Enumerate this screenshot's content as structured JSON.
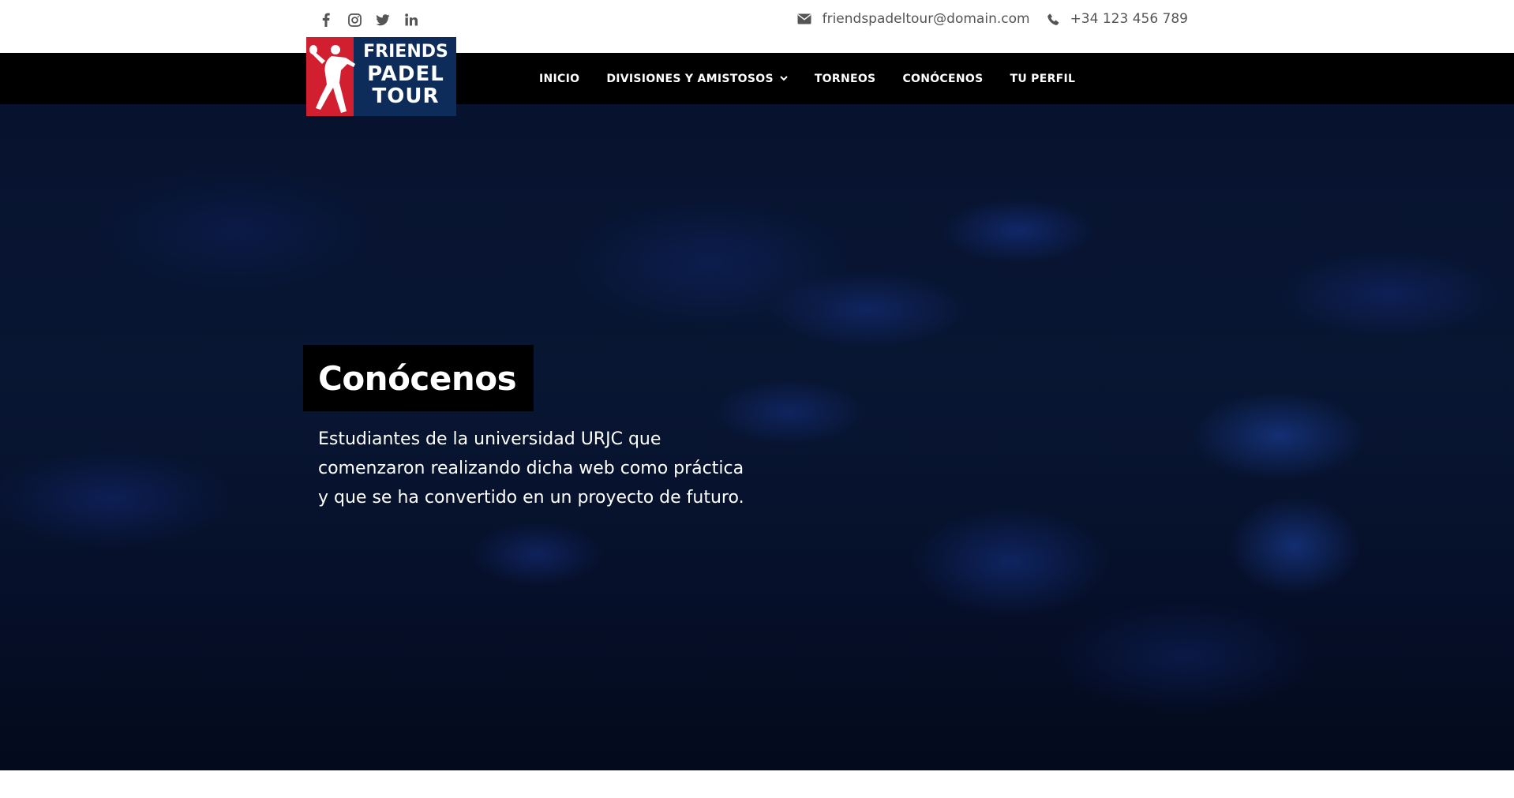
{
  "topbar": {
    "social": [
      {
        "name": "facebook-icon"
      },
      {
        "name": "instagram-icon"
      },
      {
        "name": "twitter-icon"
      },
      {
        "name": "linkedin-icon"
      }
    ],
    "email": "friendspadeltour@domain.com",
    "phone": "+34 123 456 789"
  },
  "logo": {
    "line1": "FRIENDS",
    "line2": "PADEL",
    "line3": "TOUR",
    "colors": {
      "red": "#d21f2f",
      "navy": "#0e2c5a"
    }
  },
  "nav": {
    "items": [
      {
        "label": "INICIO"
      },
      {
        "label": "DIVISIONES Y AMISTOSOS",
        "has_dropdown": true
      },
      {
        "label": "TORNEOS"
      },
      {
        "label": "CONÓCENOS"
      },
      {
        "label": "TU PERFIL"
      }
    ]
  },
  "hero": {
    "title": "Conócenos",
    "description": "Estudiantes de la universidad URJC que comenzaron realizando dicha web como práctica y que se ha convertido en un proyecto de futuro."
  }
}
